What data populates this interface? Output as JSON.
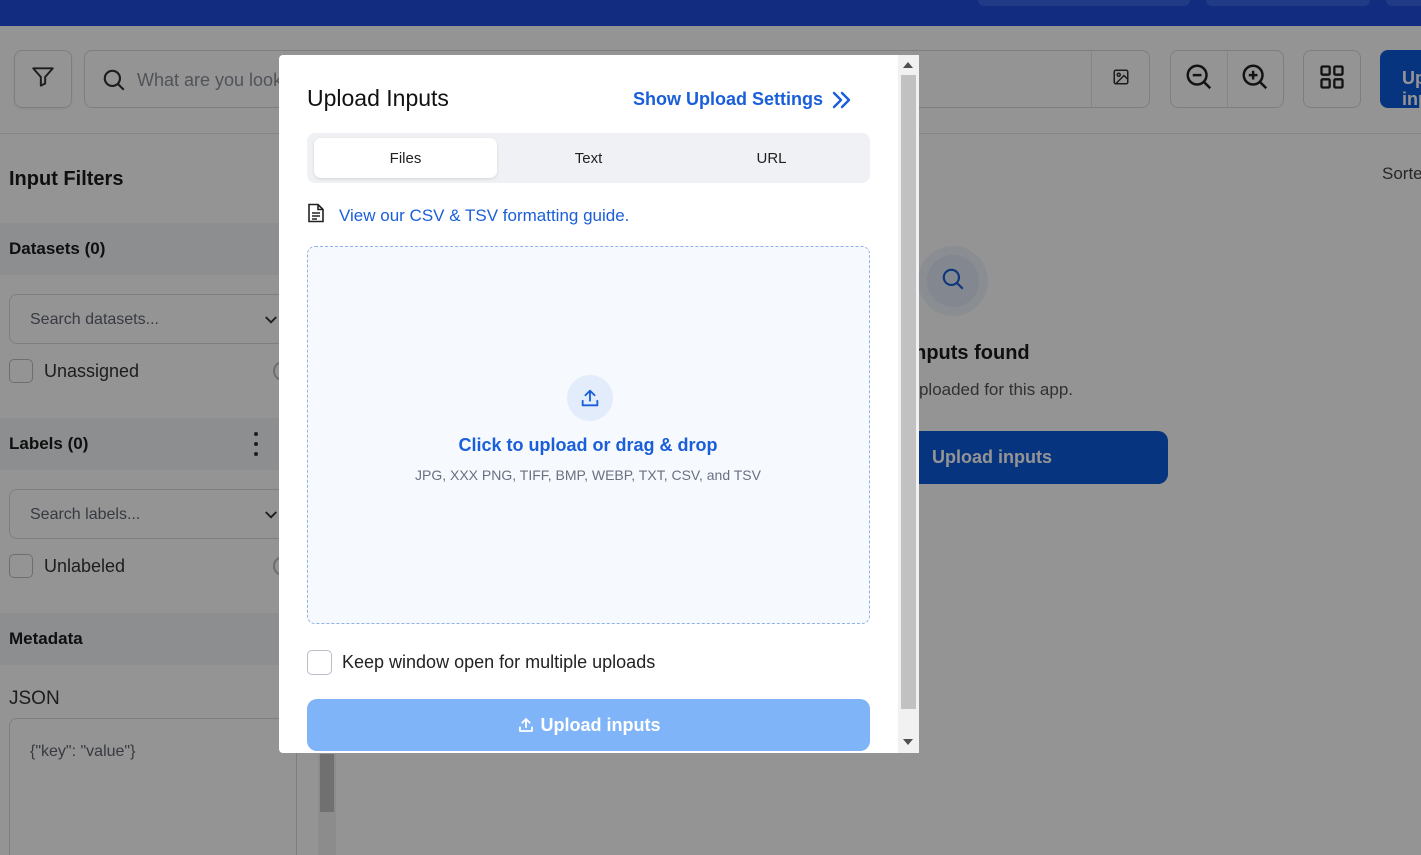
{
  "toolbar": {
    "search_placeholder": "What are you looking for?",
    "upload_button_label": "Upload inputs"
  },
  "sidebar": {
    "title": "Input Filters",
    "datasets": {
      "label": "Datasets (0)",
      "search_placeholder": "Search datasets...",
      "checkbox_label": "Unassigned"
    },
    "labels": {
      "label": "Labels (0)",
      "search_placeholder": "Search labels...",
      "checkbox_label": "Unlabeled"
    },
    "metadata": {
      "label": "Metadata",
      "json_label": "JSON",
      "json_placeholder": "{\"key\": \"value\"}"
    }
  },
  "main": {
    "sorted_label": "Sorted by",
    "empty_title": "No inputs found",
    "empty_subtitle": "No inputs uploaded for this app.",
    "empty_button": "Upload inputs"
  },
  "modal": {
    "title": "Upload Inputs",
    "settings_link": "Show Upload Settings",
    "tabs": [
      {
        "label": "Files",
        "active": true
      },
      {
        "label": "Text",
        "active": false
      },
      {
        "label": "URL",
        "active": false
      }
    ],
    "guide_link": "View our CSV & TSV formatting guide.",
    "dropzone": {
      "main": "Click to upload or drag & drop",
      "sub": "JPG, XXX PNG, TIFF, BMP, WEBP, TXT, CSV, and TSV"
    },
    "keep_open_label": "Keep window open for multiple uploads",
    "upload_button": "Upload inputs"
  },
  "colors": {
    "brand": "#1f4fdc",
    "primary_button": "#0b5bd9",
    "link": "#1a5fd9",
    "disabled_button": "#80b4f8"
  }
}
